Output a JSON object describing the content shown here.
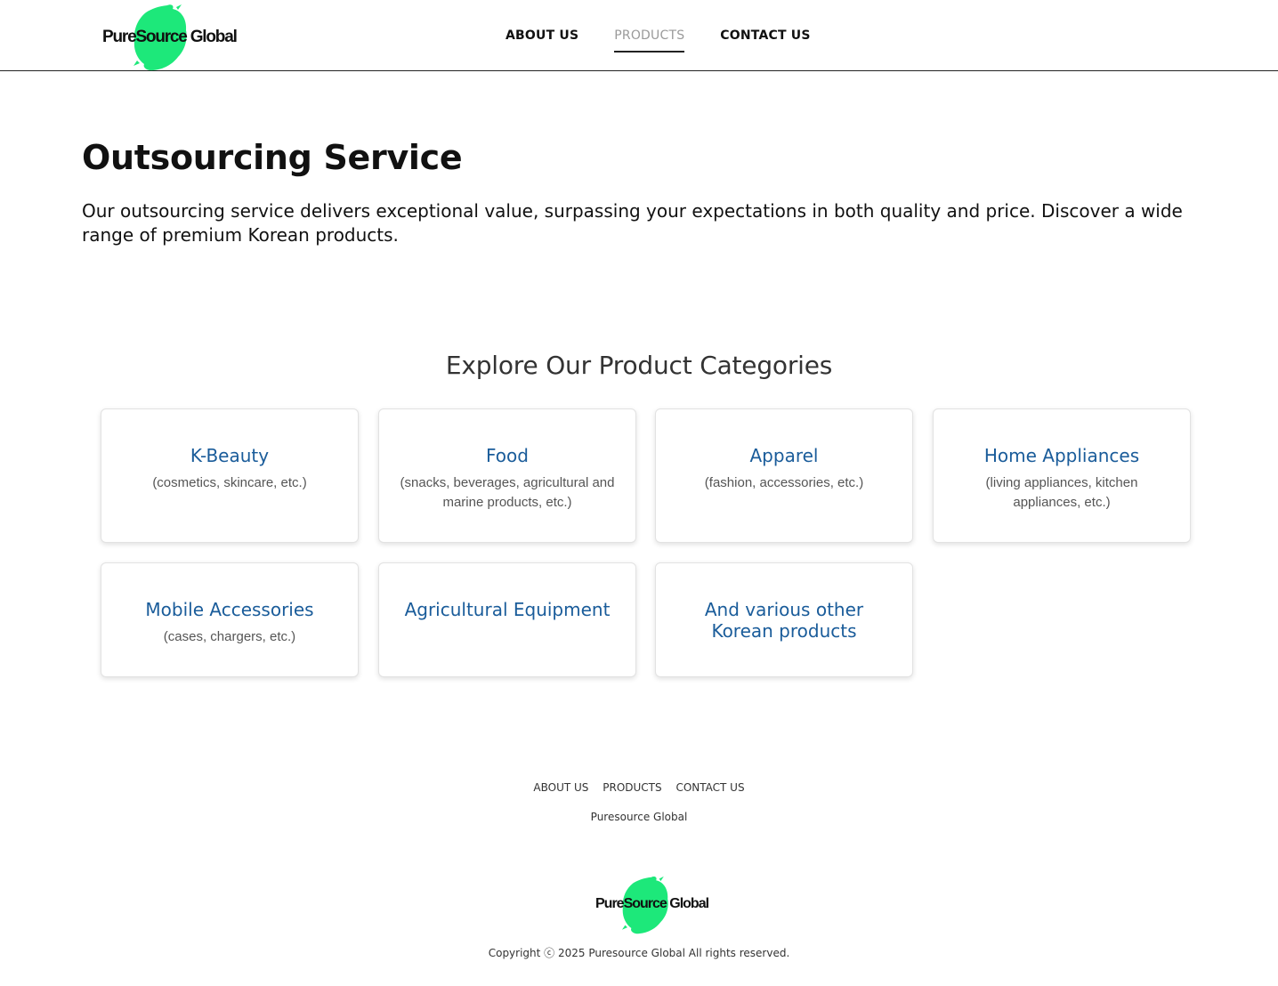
{
  "header": {
    "logo_text": "PureSource Global",
    "nav": [
      {
        "label": "ABOUT US",
        "active": false
      },
      {
        "label": "PRODUCTS",
        "active": true
      },
      {
        "label": "CONTACT US",
        "active": false
      }
    ]
  },
  "intro": {
    "title": "Outsourcing Service",
    "description": "Our outsourcing service delivers exceptional value, surpassing your expectations in both quality and price. Discover a wide range of premium Korean products."
  },
  "categories": {
    "heading": "Explore Our Product Categories",
    "items": [
      {
        "name": "K-Beauty",
        "desc": "(cosmetics, skincare, etc.)"
      },
      {
        "name": "Food",
        "desc": "(snacks, beverages, agricultural and marine products, etc.)"
      },
      {
        "name": "Apparel",
        "desc": "(fashion, accessories, etc.)"
      },
      {
        "name": "Home Appliances",
        "desc": "(living appliances, kitchen appliances, etc.)"
      },
      {
        "name": "Mobile Accessories",
        "desc": "(cases, chargers, etc.)"
      },
      {
        "name": "Agricultural Equipment",
        "desc": ""
      },
      {
        "name": "And various other Korean products",
        "desc": ""
      }
    ]
  },
  "footer": {
    "nav": [
      "ABOUT US",
      "PRODUCTS",
      "CONTACT US"
    ],
    "company": "Puresource Global",
    "logo_text": "PureSource Global",
    "copyright": "Copyright ⓒ 2025 Puresource Global All rights reserved."
  },
  "colors": {
    "brand_green": "#1de87a",
    "category_blue": "#1a5c9a",
    "nav_muted": "#9a9a9a"
  }
}
